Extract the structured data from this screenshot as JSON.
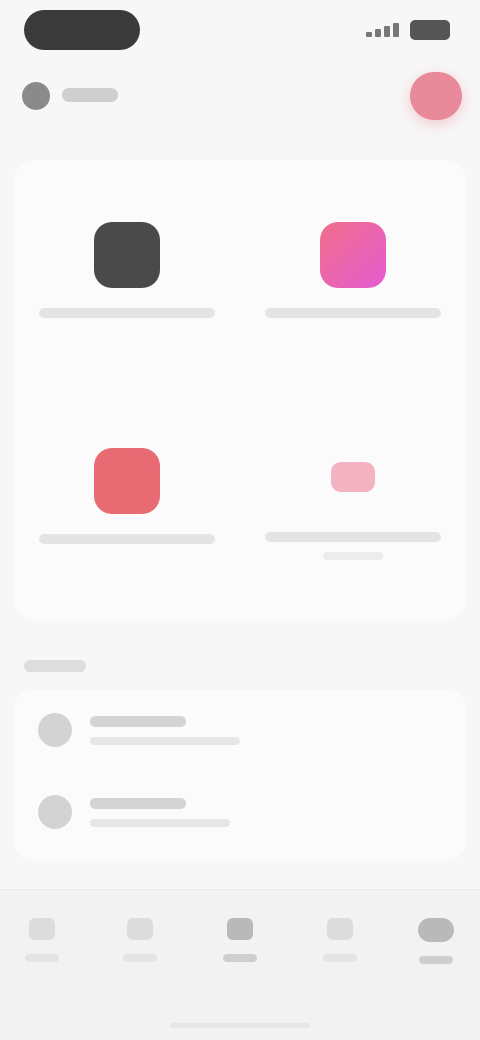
{
  "colors": {
    "accent_pink": "#e98a9a",
    "tile_dark": "#4a4a4a",
    "tile_magenta": "#ec5fb4",
    "tile_red": "#e86b74",
    "tile_light_pink": "#f3b3c2"
  },
  "header": {
    "icon": "user-icon",
    "action_icon": "profile-icon"
  },
  "tiles": [
    {
      "icon": "app-icon",
      "color": "#4a4a4a"
    },
    {
      "icon": "app-icon",
      "color": "#ec5fb4"
    },
    {
      "icon": "app-icon",
      "color": "#e86b74"
    },
    {
      "icon": "app-icon",
      "color": "#f3b3c2"
    }
  ],
  "list": {
    "items": [
      {
        "icon": "item-icon"
      },
      {
        "icon": "item-icon"
      }
    ]
  },
  "nav": {
    "items": [
      {
        "icon": "home-icon"
      },
      {
        "icon": "search-icon"
      },
      {
        "icon": "center-icon"
      },
      {
        "icon": "chat-icon"
      },
      {
        "icon": "profile-icon"
      }
    ]
  }
}
